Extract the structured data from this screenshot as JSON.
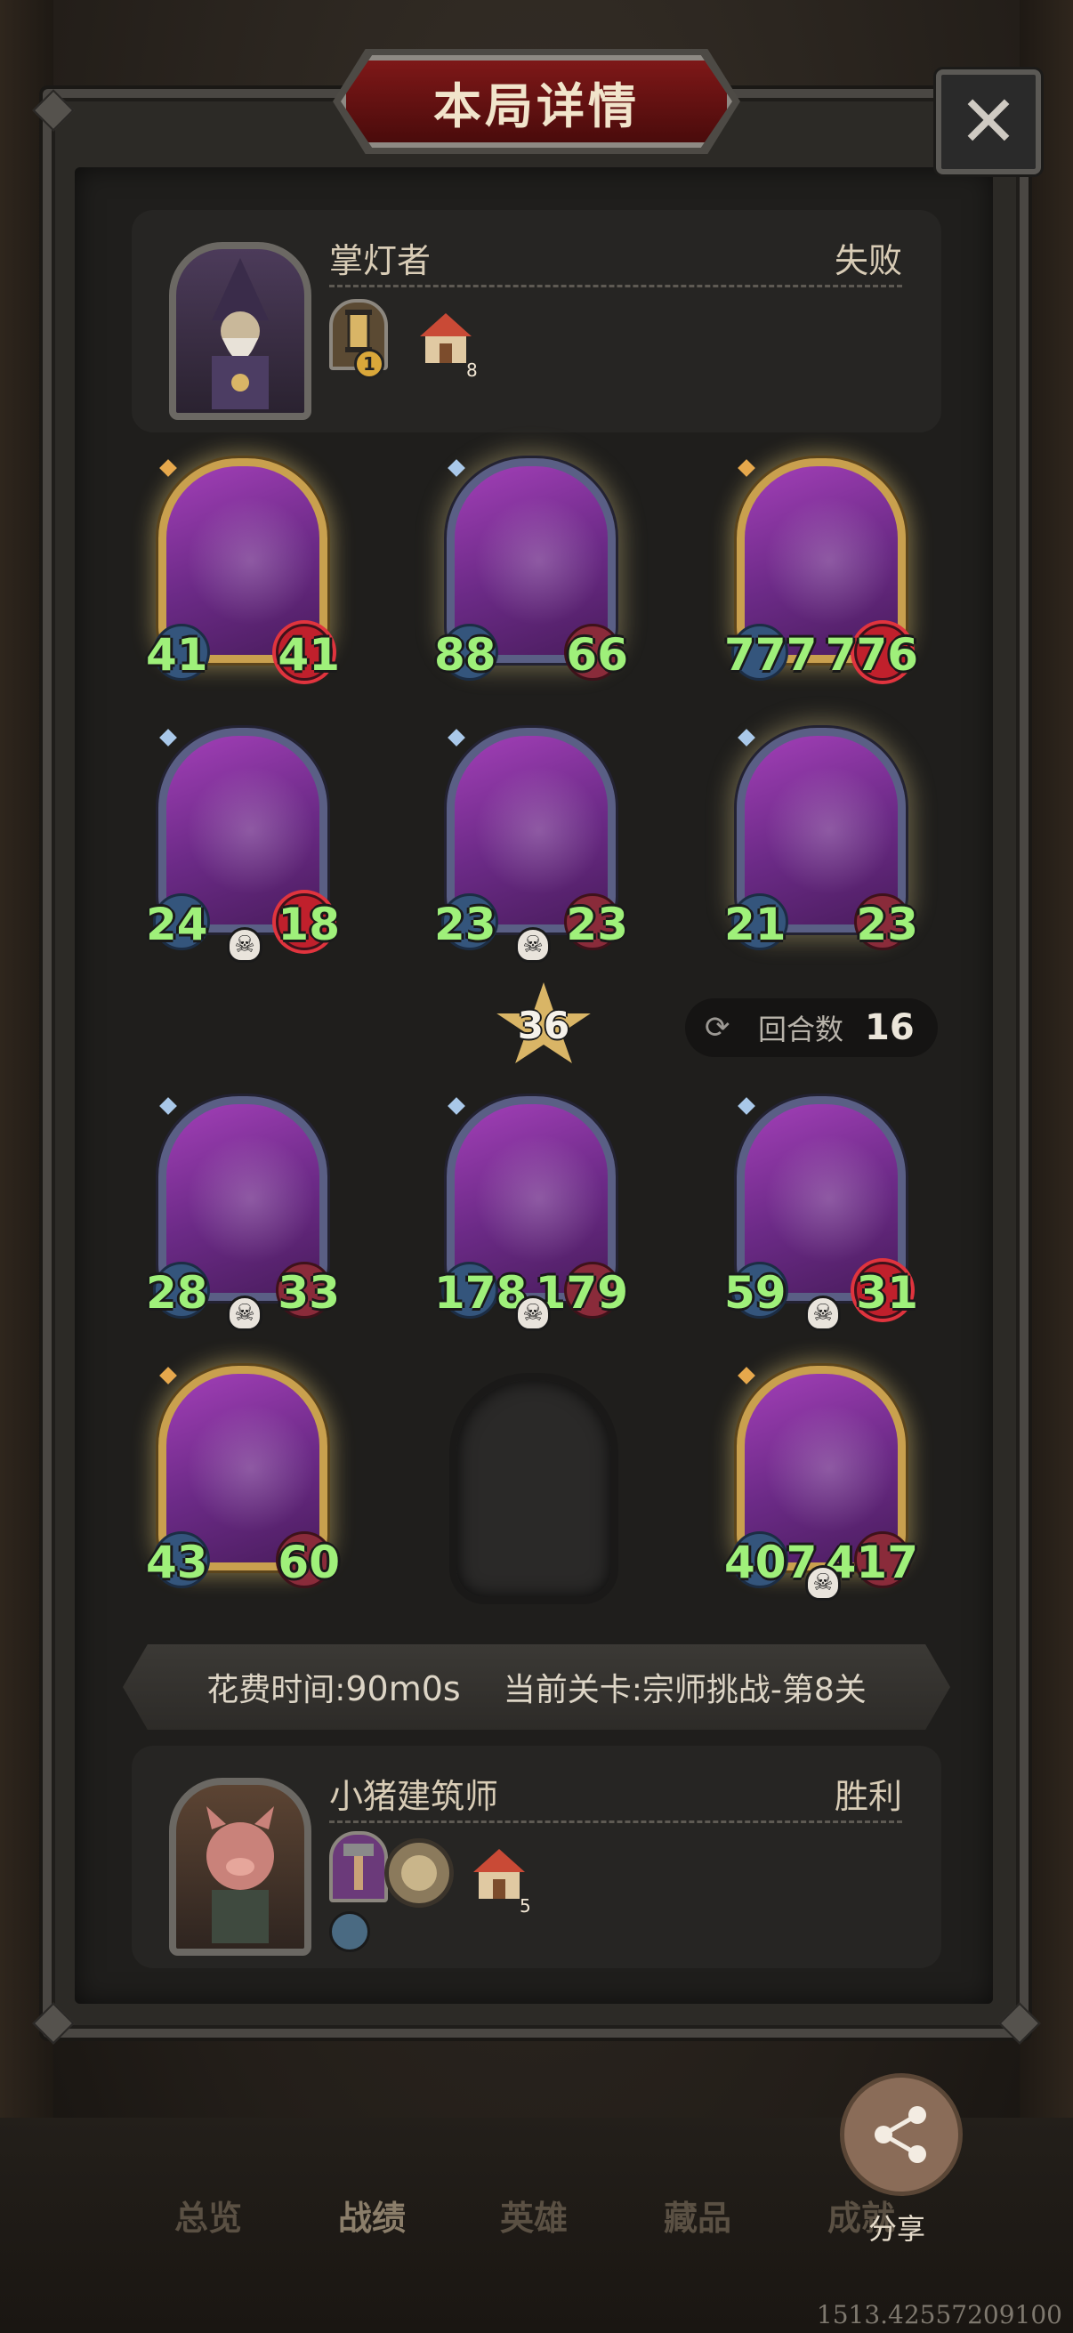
{
  "title": "本局详情",
  "close_icon": "close-icon",
  "top_player": {
    "name": "掌灯者",
    "result": "失败",
    "lantern_level": "1",
    "house_level": "8"
  },
  "enemy_board": [
    {
      "atk": "41",
      "hp": "41",
      "frame": "gold",
      "hp_style": "red",
      "skull": false
    },
    {
      "atk": "88",
      "hp": "66",
      "frame": "glow",
      "hp_style": "normal",
      "skull": false
    },
    {
      "atk": "777",
      "hp": "776",
      "frame": "gold",
      "hp_style": "red",
      "skull": false
    },
    {
      "atk": "24",
      "hp": "18",
      "frame": "blue",
      "hp_style": "red",
      "skull": true
    },
    {
      "atk": "23",
      "hp": "23",
      "frame": "blue",
      "hp_style": "normal",
      "skull": true
    },
    {
      "atk": "21",
      "hp": "23",
      "frame": "glow",
      "hp_style": "normal",
      "skull": false
    }
  ],
  "level_star": "36",
  "rounds": {
    "label": "回合数",
    "value": "16"
  },
  "player_board": [
    {
      "atk": "28",
      "hp": "33",
      "frame": "blue",
      "hp_style": "normal",
      "skull": true
    },
    {
      "atk": "178",
      "hp": "179",
      "frame": "blue",
      "hp_style": "normal",
      "skull": true
    },
    {
      "atk": "59",
      "hp": "31",
      "frame": "blue",
      "hp_style": "red",
      "skull": true
    },
    {
      "atk": "43",
      "hp": "60",
      "frame": "gold",
      "hp_style": "normal",
      "skull": false
    },
    {
      "atk": "407",
      "hp": "417",
      "frame": "gold",
      "hp_style": "normal",
      "skull": true
    }
  ],
  "info": {
    "time_label": "花费时间:",
    "time_value": "90m0s",
    "stage_label": "当前关卡:",
    "stage_value": "宗师挑战-第8关"
  },
  "bottom_player": {
    "name": "小猪建筑师",
    "result": "胜利",
    "house_level": "5"
  },
  "nav": {
    "items": [
      "总览",
      "战绩",
      "英雄",
      "藏品",
      "成就"
    ],
    "active": "战绩"
  },
  "share_label": "分享",
  "coords_text": "1513.42557209100"
}
